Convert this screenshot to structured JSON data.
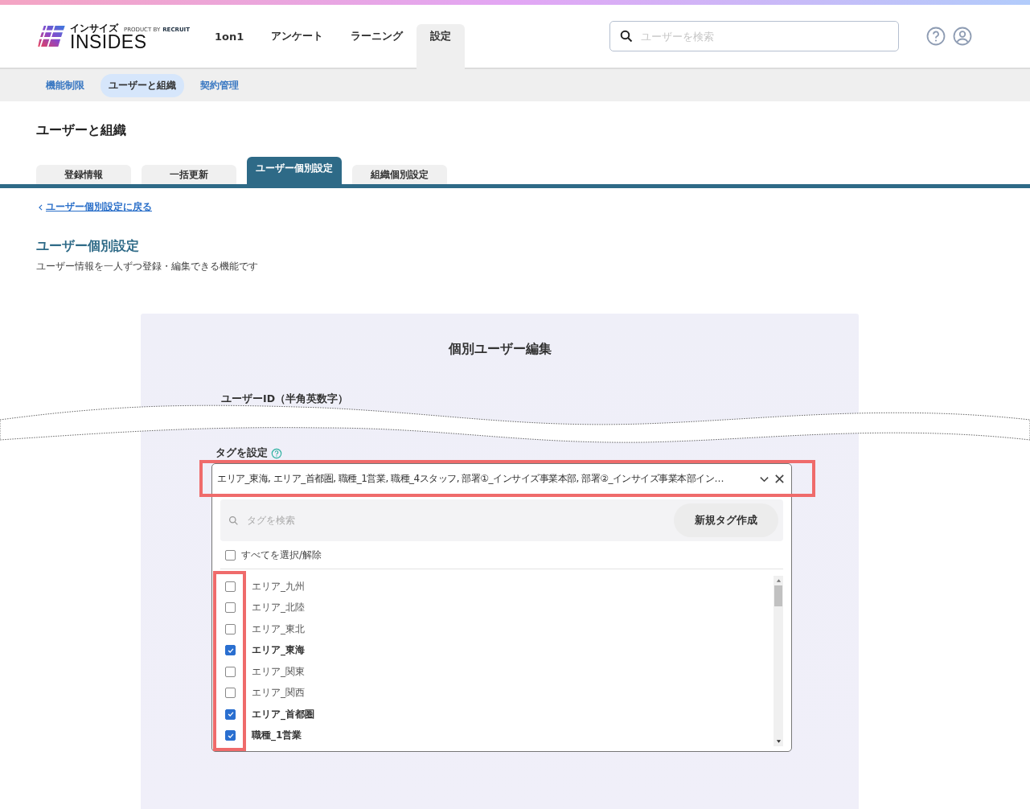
{
  "logo": {
    "kana": "インサイズ",
    "name": "INSIDES",
    "product_by": "PRODUCT BY",
    "company": "RECRUIT"
  },
  "nav": [
    {
      "label": "1on1",
      "selected": false
    },
    {
      "label": "アンケート",
      "selected": false
    },
    {
      "label": "ラーニング",
      "selected": false
    },
    {
      "label": "設定",
      "selected": true
    }
  ],
  "search": {
    "placeholder": "ユーザーを検索"
  },
  "subnav": [
    {
      "label": "機能制限",
      "selected": false
    },
    {
      "label": "ユーザーと組織",
      "selected": true
    },
    {
      "label": "契約管理",
      "selected": false
    }
  ],
  "page_title": "ユーザーと組織",
  "tabs": [
    {
      "label": "登録情報",
      "selected": false
    },
    {
      "label": "一括更新",
      "selected": false
    },
    {
      "label": "ユーザー個別設定",
      "selected": true
    },
    {
      "label": "組織個別設定",
      "selected": false
    }
  ],
  "back_link": "ユーザー個別設定に戻る",
  "section_title": "ユーザー個別設定",
  "section_description": "ユーザー情報を一人ずつ登録・編集できる機能です",
  "card": {
    "title": "個別ユーザー編集",
    "user_id_label": "ユーザーID（半角英数字）",
    "tag_label": "タグを設定",
    "tag_value": "エリア_東海, エリア_首都圏, 職種_1営業, 職種_4スタッフ, 部署①_インサイズ事業本部, 部署②_インサイズ事業本部イン…",
    "tag_search_placeholder": "タグを検索",
    "new_tag_button": "新規タグ作成",
    "select_all": {
      "label": "すべてを選択/解除",
      "checked": false
    },
    "tags": [
      {
        "label": "エリア_九州",
        "checked": false
      },
      {
        "label": "エリア_北陸",
        "checked": false
      },
      {
        "label": "エリア_東北",
        "checked": false
      },
      {
        "label": "エリア_東海",
        "checked": true
      },
      {
        "label": "エリア_関東",
        "checked": false
      },
      {
        "label": "エリア_関西",
        "checked": false
      },
      {
        "label": "エリア_首都圏",
        "checked": true
      },
      {
        "label": "職種_1営業",
        "checked": true
      }
    ]
  }
}
